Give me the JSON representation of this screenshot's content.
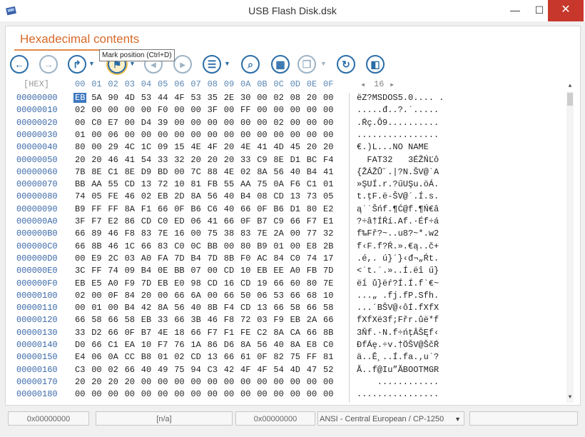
{
  "window": {
    "title": "USB Flash Disk.dsk",
    "minimize": "—",
    "maximize": "☐",
    "close": "✕"
  },
  "tab": {
    "title": "Hexadecimal contents"
  },
  "toolbar": {
    "buttons": [
      {
        "name": "back-icon",
        "glyph": "←"
      },
      {
        "name": "forward-icon",
        "glyph": "→"
      },
      {
        "name": "goto-icon",
        "glyph": "↱"
      },
      {
        "name": "mark-position-icon",
        "glyph": "⚑"
      },
      {
        "name": "prev-mark-icon",
        "glyph": "◂"
      },
      {
        "name": "next-mark-icon",
        "glyph": "▸"
      },
      {
        "name": "list-icon",
        "glyph": "☰"
      },
      {
        "name": "find-icon",
        "glyph": "⌕"
      },
      {
        "name": "grid-icon",
        "glyph": "▦"
      },
      {
        "name": "copy-icon",
        "glyph": "❐"
      },
      {
        "name": "refresh-icon",
        "glyph": "↻"
      },
      {
        "name": "panel-icon",
        "glyph": "◧"
      }
    ],
    "tooltip": "Mark position (Ctrl+D)"
  },
  "hex": {
    "header_label": "[HEX]",
    "columns": [
      "00",
      "01",
      "02",
      "03",
      "04",
      "05",
      "06",
      "07",
      "08",
      "09",
      "0A",
      "0B",
      "0C",
      "0D",
      "0E",
      "0F"
    ],
    "width_label": "16",
    "rows": [
      {
        "offset": "00000000",
        "bytes": [
          "EB",
          "5A",
          "90",
          "4D",
          "53",
          "44",
          "4F",
          "53",
          "35",
          "2E",
          "30",
          "00",
          "02",
          "08",
          "20",
          "00"
        ],
        "text": "ëZ?MSDOS5.0.... ."
      },
      {
        "offset": "00000010",
        "bytes": [
          "02",
          "00",
          "00",
          "00",
          "00",
          "F0",
          "00",
          "00",
          "3F",
          "00",
          "FF",
          "00",
          "00",
          "00",
          "00",
          "00"
        ],
        "text": ".....đ..?.˙....."
      },
      {
        "offset": "00000020",
        "bytes": [
          "00",
          "C0",
          "E7",
          "00",
          "D4",
          "39",
          "00",
          "00",
          "00",
          "00",
          "00",
          "00",
          "02",
          "00",
          "00",
          "00"
        ],
        "text": ".Ŕç.Ô9.........."
      },
      {
        "offset": "00000030",
        "bytes": [
          "01",
          "00",
          "06",
          "00",
          "00",
          "00",
          "00",
          "00",
          "00",
          "00",
          "00",
          "00",
          "00",
          "00",
          "00",
          "00"
        ],
        "text": "................"
      },
      {
        "offset": "00000040",
        "bytes": [
          "80",
          "00",
          "29",
          "4C",
          "1C",
          "09",
          "15",
          "4E",
          "4F",
          "20",
          "4E",
          "41",
          "4D",
          "45",
          "20",
          "20"
        ],
        "text": "€.)L...NO NAME  "
      },
      {
        "offset": "00000050",
        "bytes": [
          "20",
          "20",
          "46",
          "41",
          "54",
          "33",
          "32",
          "20",
          "20",
          "20",
          "33",
          "C9",
          "8E",
          "D1",
          "BC",
          "F4"
        ],
        "text": "  FAT32   3ÉŽŃĽô"
      },
      {
        "offset": "00000060",
        "bytes": [
          "7B",
          "8E",
          "C1",
          "8E",
          "D9",
          "BD",
          "00",
          "7C",
          "88",
          "4E",
          "02",
          "8A",
          "56",
          "40",
          "B4",
          "41"
        ],
        "text": "{ŽÁŽŮ˝.|?N.ŠV@´A"
      },
      {
        "offset": "00000070",
        "bytes": [
          "BB",
          "AA",
          "55",
          "CD",
          "13",
          "72",
          "10",
          "81",
          "FB",
          "55",
          "AA",
          "75",
          "0A",
          "F6",
          "C1",
          "01"
        ],
        "text": "»ŞUÍ.r.?űUŞu.öÁ."
      },
      {
        "offset": "00000080",
        "bytes": [
          "74",
          "05",
          "FE",
          "46",
          "02",
          "EB",
          "2D",
          "8A",
          "56",
          "40",
          "B4",
          "08",
          "CD",
          "13",
          "73",
          "05"
        ],
        "text": "t.ţF.ë-ŠV@´.Í.s."
      },
      {
        "offset": "00000090",
        "bytes": [
          "B9",
          "FF",
          "FF",
          "8A",
          "F1",
          "66",
          "0F",
          "B6",
          "C6",
          "40",
          "66",
          "0F",
          "B6",
          "D1",
          "80",
          "E2"
        ],
        "text": "ą˙˙Šńf.¶Ć@f.¶Ń€â"
      },
      {
        "offset": "000000A0",
        "bytes": [
          "3F",
          "F7",
          "E2",
          "86",
          "CD",
          "C0",
          "ED",
          "06",
          "41",
          "66",
          "0F",
          "B7",
          "C9",
          "66",
          "F7",
          "E1"
        ],
        "text": "?÷â†ÍŔí.Af.·Éf÷á"
      },
      {
        "offset": "000000B0",
        "bytes": [
          "66",
          "89",
          "46",
          "F8",
          "83",
          "7E",
          "16",
          "00",
          "75",
          "38",
          "83",
          "7E",
          "2A",
          "00",
          "77",
          "32"
        ],
        "text": "f‰Fř?~..u8?~*.w2"
      },
      {
        "offset": "000000C0",
        "bytes": [
          "66",
          "8B",
          "46",
          "1C",
          "66",
          "83",
          "C0",
          "0C",
          "BB",
          "00",
          "80",
          "B9",
          "01",
          "00",
          "E8",
          "2B"
        ],
        "text": "f‹F.f?Ŕ.».€ą..č+"
      },
      {
        "offset": "000000D0",
        "bytes": [
          "00",
          "E9",
          "2C",
          "03",
          "A0",
          "FA",
          "7D",
          "B4",
          "7D",
          "8B",
          "F0",
          "AC",
          "84",
          "C0",
          "74",
          "17"
        ],
        "text": ".é,. ú}´}‹đ¬„Ŕt."
      },
      {
        "offset": "000000E0",
        "bytes": [
          "3C",
          "FF",
          "74",
          "09",
          "B4",
          "0E",
          "BB",
          "07",
          "00",
          "CD",
          "10",
          "EB",
          "EE",
          "A0",
          "FB",
          "7D"
        ],
        "text": "<˙t.´.»..Í.ëî ű}"
      },
      {
        "offset": "000000F0",
        "bytes": [
          "EB",
          "E5",
          "A0",
          "F9",
          "7D",
          "EB",
          "E0",
          "98",
          "CD",
          "16",
          "CD",
          "19",
          "66",
          "60",
          "80",
          "7E"
        ],
        "text": "ëĺ ů}ëŕ?Í.Í.f`€~"
      },
      {
        "offset": "00000100",
        "bytes": [
          "02",
          "00",
          "0F",
          "84",
          "20",
          "00",
          "66",
          "6A",
          "00",
          "66",
          "50",
          "06",
          "53",
          "66",
          "68",
          "10"
        ],
        "text": "...„ .fj.fP.Sfh."
      },
      {
        "offset": "00000110",
        "bytes": [
          "00",
          "01",
          "00",
          "B4",
          "42",
          "8A",
          "56",
          "40",
          "8B",
          "F4",
          "CD",
          "13",
          "66",
          "58",
          "66",
          "58"
        ],
        "text": "...´BŠV@‹ôÍ.fXfX"
      },
      {
        "offset": "00000120",
        "bytes": [
          "66",
          "58",
          "66",
          "58",
          "EB",
          "33",
          "66",
          "3B",
          "46",
          "F8",
          "72",
          "03",
          "F9",
          "EB",
          "2A",
          "66"
        ],
        "text": "fXfXë3f;Fřr.ůë*f"
      },
      {
        "offset": "00000130",
        "bytes": [
          "33",
          "D2",
          "66",
          "0F",
          "B7",
          "4E",
          "18",
          "66",
          "F7",
          "F1",
          "FE",
          "C2",
          "8A",
          "CA",
          "66",
          "8B"
        ],
        "text": "3Ňf.·N.f÷ńţÂŠĘf‹"
      },
      {
        "offset": "00000140",
        "bytes": [
          "D0",
          "66",
          "C1",
          "EA",
          "10",
          "F7",
          "76",
          "1A",
          "86",
          "D6",
          "8A",
          "56",
          "40",
          "8A",
          "E8",
          "C0"
        ],
        "text": "ĐfÁę.÷v.†ÖŠV@ŠčŔ"
      },
      {
        "offset": "00000150",
        "bytes": [
          "E4",
          "06",
          "0A",
          "CC",
          "B8",
          "01",
          "02",
          "CD",
          "13",
          "66",
          "61",
          "0F",
          "82",
          "75",
          "FF",
          "81"
        ],
        "text": "ä..Ě¸..Í.fa.‚u˙?"
      },
      {
        "offset": "00000160",
        "bytes": [
          "C3",
          "00",
          "02",
          "66",
          "40",
          "49",
          "75",
          "94",
          "C3",
          "42",
          "4F",
          "4F",
          "54",
          "4D",
          "47",
          "52"
        ],
        "text": "Ă..f@Iu”ĂBOOTMGR"
      },
      {
        "offset": "00000170",
        "bytes": [
          "20",
          "20",
          "20",
          "20",
          "00",
          "00",
          "00",
          "00",
          "00",
          "00",
          "00",
          "00",
          "00",
          "00",
          "00",
          "00"
        ],
        "text": "    ............"
      },
      {
        "offset": "00000180",
        "bytes": [
          "00",
          "00",
          "00",
          "00",
          "00",
          "00",
          "00",
          "00",
          "00",
          "00",
          "00",
          "00",
          "00",
          "00",
          "00",
          "00"
        ],
        "text": "................"
      }
    ]
  },
  "statusbar": {
    "offset": "0x00000000",
    "value": "[n/a]",
    "position": "0x00000000",
    "encoding": "ANSI - Central European / CP-1250",
    "extra": ""
  }
}
